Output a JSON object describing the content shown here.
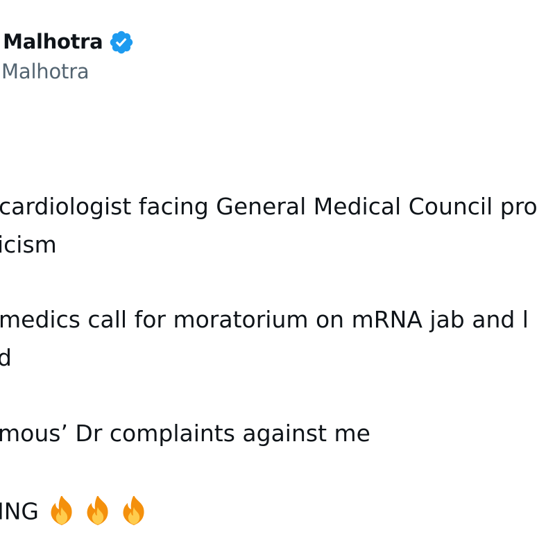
{
  "author": {
    "display_name": "n Malhotra",
    "handle": "mMalhotra",
    "verified_icon": "verified-badge-icon",
    "badge_color": "#1d9bf0"
  },
  "tweet": {
    "lines": [
      "cardiologist facing General Medical Council pro",
      "icism",
      "medics call for moratorium on mRNA jab and l",
      "d",
      "mous’ Dr complaints against me",
      "ING"
    ],
    "emoji": [
      "fire-icon",
      "fire-icon",
      "fire-icon"
    ]
  }
}
